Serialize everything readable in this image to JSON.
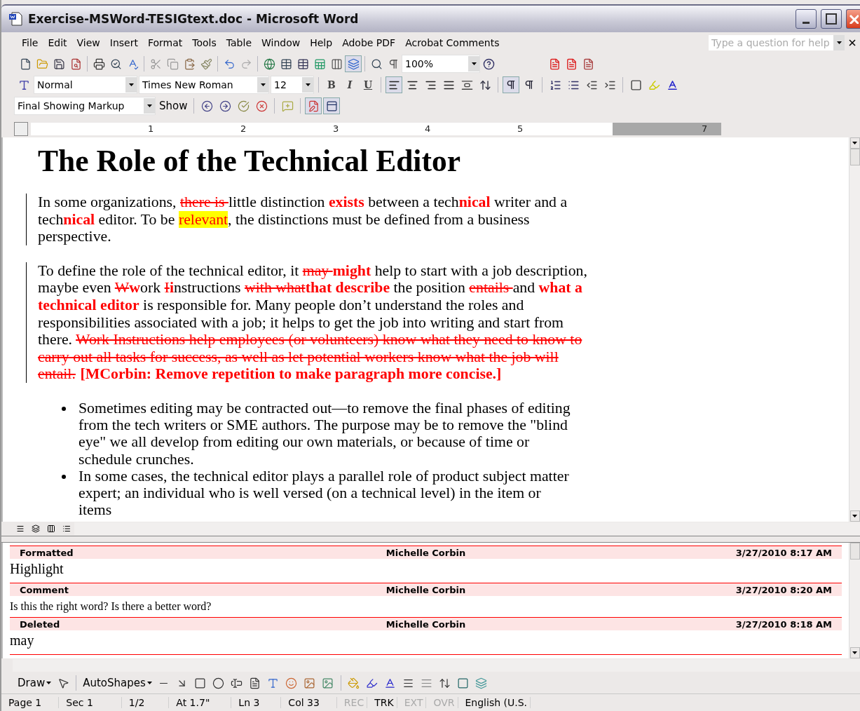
{
  "window": {
    "title": "Exercise-MSWord-TESIGtext.doc - Microsoft Word"
  },
  "menu": [
    "File",
    "Edit",
    "View",
    "Insert",
    "Format",
    "Tools",
    "Table",
    "Window",
    "Help",
    "Adobe PDF",
    "Acrobat Comments"
  ],
  "help_box": {
    "placeholder": "Type a question for help"
  },
  "standard_toolbar": {
    "zoom": "100%"
  },
  "formatting_toolbar": {
    "style": "Normal",
    "font": "Times New Roman",
    "size": "12",
    "bold": "B",
    "italic": "I",
    "underline": "U",
    "align_buttons": [
      {
        "selected": true
      },
      {
        "selected": false
      },
      {
        "selected": false
      },
      {
        "selected": false
      }
    ],
    "direction_buttons": [
      {
        "selected": true
      },
      {
        "selected": false
      }
    ]
  },
  "reviewing_toolbar": {
    "display": "Final Showing Markup",
    "show": "Show"
  },
  "ruler": [
    "1",
    "2",
    "3",
    "4",
    "5",
    "7"
  ],
  "document": {
    "title": "The Role of the Technical Editor",
    "paragraphs": [
      {
        "changed": true,
        "runs": [
          {
            "kind": "plain",
            "text": "In some organizations, "
          },
          {
            "kind": "deleted",
            "text": "there is "
          },
          {
            "kind": "plain",
            "text": "little distinction "
          },
          {
            "kind": "inserted",
            "text": "exists"
          },
          {
            "kind": "plain",
            "text": " between a tech"
          },
          {
            "kind": "inserted",
            "text": "nical"
          },
          {
            "kind": "plain",
            "text": " writer and a tech"
          },
          {
            "kind": "inserted",
            "text": "nical"
          },
          {
            "kind": "plain",
            "text": " editor. To be "
          },
          {
            "kind": "highlighted",
            "text": "relevant"
          },
          {
            "kind": "plain",
            "text": ", the distinctions must be defined from a business perspective."
          }
        ]
      },
      {
        "changed": true,
        "runs": [
          {
            "kind": "plain",
            "text": "To define the role of the technical editor, it "
          },
          {
            "kind": "deleted",
            "text": "may "
          },
          {
            "kind": "inserted",
            "text": "might"
          },
          {
            "kind": "plain",
            "text": " help to start with a job description, maybe even "
          },
          {
            "kind": "deleted",
            "text": "W"
          },
          {
            "kind": "inserted",
            "text": "w"
          },
          {
            "kind": "plain",
            "text": "ork "
          },
          {
            "kind": "deleted",
            "text": "I"
          },
          {
            "kind": "inserted",
            "text": "i"
          },
          {
            "kind": "plain",
            "text": "nstructions "
          },
          {
            "kind": "deleted",
            "text": "with what"
          },
          {
            "kind": "inserted",
            "text": "that describe"
          },
          {
            "kind": "plain",
            "text": " the position "
          },
          {
            "kind": "deleted",
            "text": "entails "
          },
          {
            "kind": "plain",
            "text": "and "
          },
          {
            "kind": "inserted",
            "text": "what a technical editor"
          },
          {
            "kind": "plain",
            "text": " is responsible for. Many people don’t understand the roles and responsibilities associated with a job; it helps to get the job into writing and start from there. "
          },
          {
            "kind": "deleted",
            "text": "Work Instructions help employees (or volunteers) know what they need to know to carry out all tasks for success, as well as let potential workers know what the job will entail."
          },
          {
            "kind": "comment",
            "text": "[MCorbin: Remove repetition to make paragraph more concise.]"
          }
        ]
      }
    ],
    "bullets": [
      "Sometimes editing may be contracted out—to remove the final phases of editing from the tech writers or SME authors. The purpose may be to remove the \"blind eye\" we all develop from editing our own materials, or because of time or schedule crunches.",
      "In some cases, the technical editor plays a parallel role of product subject matter expert; an individual who is well versed (on a technical level) in the item or items"
    ]
  },
  "reviewing_pane": [
    {
      "type": "Formatted",
      "author": "Michelle Corbin",
      "date": "3/27/2010 8:17 AM",
      "text": "Highlight",
      "kind": "change"
    },
    {
      "type": "Comment",
      "author": "Michelle Corbin",
      "date": "3/27/2010 8:20 AM",
      "text": "Is this the right word?  Is there a better word?",
      "kind": "comment"
    },
    {
      "type": "Deleted",
      "author": "Michelle Corbin",
      "date": "3/27/2010 8:18 AM",
      "text": "may",
      "kind": "change"
    }
  ],
  "drawing_toolbar": {
    "draw": "Draw",
    "autoshapes": "AutoShapes"
  },
  "status_bar": [
    {
      "text": "Page 1",
      "disabled": false
    },
    {
      "text": "Sec 1",
      "disabled": false
    },
    {
      "text": "1/2",
      "disabled": false
    },
    {
      "text": "At 1.7\"",
      "disabled": false
    },
    {
      "text": "Ln 3",
      "disabled": false
    },
    {
      "text": "Col 33",
      "disabled": false
    },
    {
      "text": "REC",
      "disabled": true
    },
    {
      "text": "TRK",
      "disabled": false
    },
    {
      "text": "EXT",
      "disabled": true
    },
    {
      "text": "OVR",
      "disabled": true
    },
    {
      "text": "English (U.S.",
      "disabled": false
    }
  ]
}
